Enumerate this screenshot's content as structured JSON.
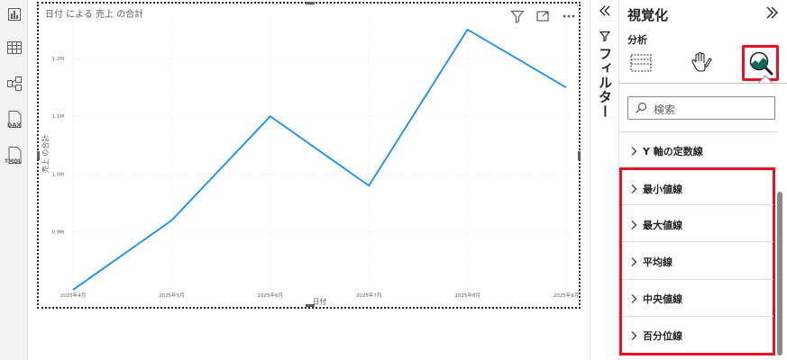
{
  "rail": {
    "items": [
      {
        "name": "report-view-icon",
        "label": ""
      },
      {
        "name": "table-view-icon",
        "label": ""
      },
      {
        "name": "model-view-icon",
        "label": ""
      },
      {
        "name": "dax-query-view-icon",
        "label": "DAX"
      },
      {
        "name": "tmdl-view-icon",
        "label": "TMDL"
      }
    ]
  },
  "visual": {
    "title": "日付 による 売上 の合計",
    "header_icons": [
      "filter-icon",
      "focus-mode-icon",
      "more-options-icon"
    ]
  },
  "chart_data": {
    "type": "line",
    "title": "日付 による 売上 の合計",
    "xlabel": "日付",
    "ylabel": "売上 の合計",
    "categories": [
      "2025年4月",
      "2025年5月",
      "2025年6月",
      "2025年7月",
      "2025年8月",
      "2025年9月"
    ],
    "values": [
      0.8,
      0.92,
      1.1,
      0.98,
      1.25,
      1.15
    ],
    "unit": "M",
    "y_ticks": [
      "0.9M",
      "1.0M",
      "1.1M",
      "1.2M"
    ],
    "y_tick_values": [
      0.9,
      1.0,
      1.1,
      1.2
    ],
    "ylim": [
      0.8,
      1.27
    ],
    "grid": true,
    "line_color": "#118DFF"
  },
  "filter_pane": {
    "label": "フィルター",
    "expand_icon": "chevron-double-left-icon"
  },
  "viz_pane": {
    "title": "視覚化",
    "collapse_icon": "chevron-double-right-icon",
    "subtitle": "分析",
    "tabs": [
      {
        "name": "build-visual-icon",
        "selected": false
      },
      {
        "name": "format-visual-icon",
        "selected": false
      },
      {
        "name": "analytics-icon",
        "selected": true
      }
    ],
    "search_placeholder": "検索",
    "sections": [
      "Y 軸の定数線",
      "最小値線",
      "最大値線",
      "平均線",
      "中央値線",
      "百分位線"
    ]
  },
  "colors": {
    "accent_line": "#118DFF",
    "highlight_red": "#E81123",
    "pane_bg": "#FFFFFF",
    "rail_bg": "#F3F2F1"
  }
}
